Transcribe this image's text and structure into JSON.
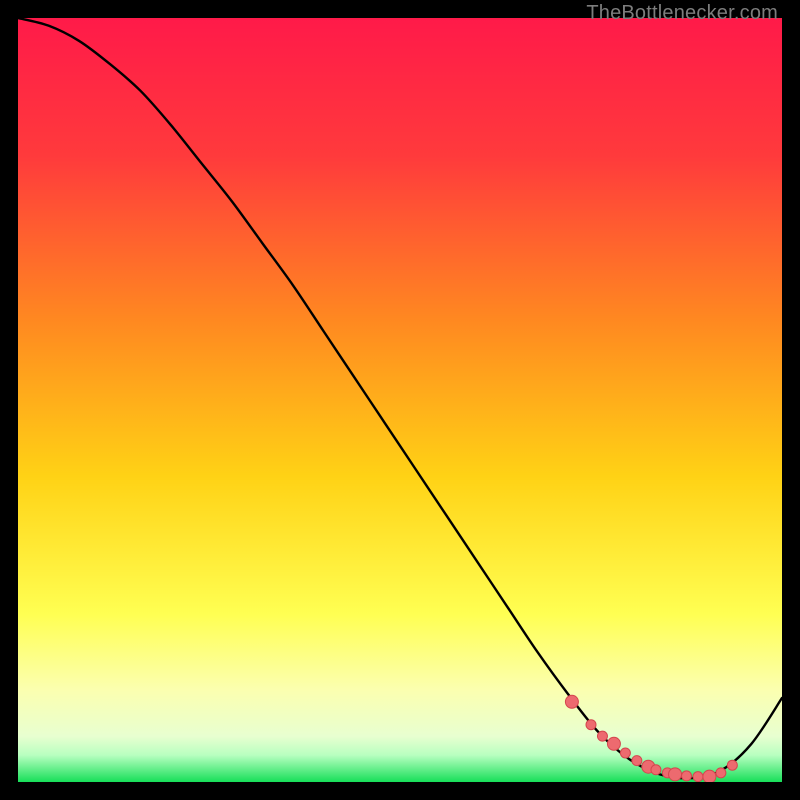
{
  "watermark": "TheBottlenecker.com",
  "colors": {
    "bg": "#000000",
    "grad_top": "#ff1a49",
    "grad_mid1": "#ff6a2a",
    "grad_mid2": "#ffd215",
    "grad_low": "#ffff70",
    "grad_pale": "#f6ffd6",
    "grad_bottom": "#18e05a",
    "curve": "#000000",
    "marker_fill": "#ed6a6f",
    "marker_stroke": "#d4464e"
  },
  "chart_data": {
    "type": "line",
    "title": "",
    "xlabel": "",
    "ylabel": "",
    "xlim": [
      0,
      100
    ],
    "ylim": [
      0,
      100
    ],
    "series": [
      {
        "name": "bottleneck-curve",
        "x": [
          0,
          4,
          8,
          12,
          16,
          20,
          24,
          28,
          32,
          36,
          40,
          44,
          48,
          52,
          56,
          60,
          64,
          68,
          72,
          76,
          80,
          84,
          88,
          92,
          96,
          100
        ],
        "y": [
          100,
          99,
          97,
          94,
          90.5,
          86,
          81,
          76,
          70.5,
          65,
          59,
          53,
          47,
          41,
          35,
          29,
          23,
          17,
          11.5,
          6.5,
          3,
          1,
          0.5,
          1.5,
          5,
          11
        ]
      }
    ],
    "markers": {
      "name": "highlight-points",
      "x": [
        72.5,
        75,
        76.5,
        78,
        79.5,
        81,
        82.5,
        83.5,
        85,
        86,
        87.5,
        89,
        90.5,
        92,
        93.5
      ],
      "y": [
        10.5,
        7.5,
        6,
        5,
        3.8,
        2.8,
        2,
        1.6,
        1.2,
        1,
        0.8,
        0.7,
        0.7,
        1.2,
        2.2
      ]
    }
  }
}
